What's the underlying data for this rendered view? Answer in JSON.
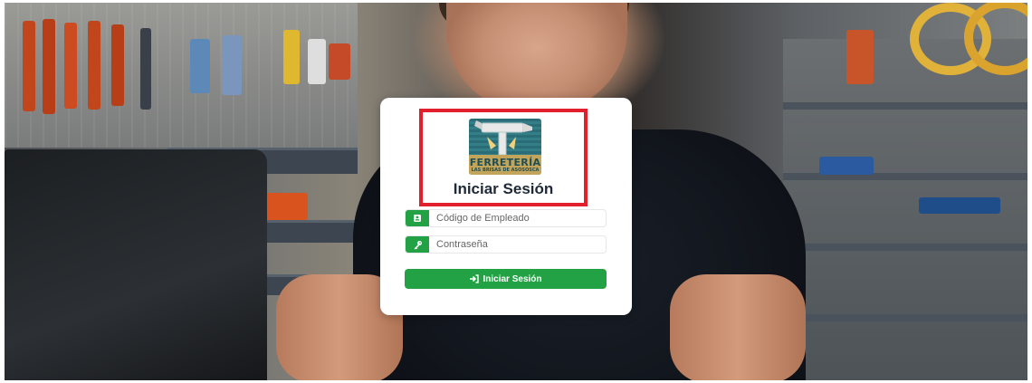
{
  "brand": {
    "logo_title": "FERRETERÍA",
    "logo_subtitle": "LAS BRISAS DE ASOSOSCA",
    "colors": {
      "accent": "#22a245",
      "highlight": "#e21f2c",
      "logo_teal": "#2b6d77",
      "logo_gold": "#c2a45b"
    }
  },
  "login": {
    "title": "Iniciar Sesión",
    "employee_code": {
      "placeholder": "Código de Empleado",
      "value": "",
      "icon": "id-card-icon"
    },
    "password": {
      "placeholder": "Contraseña",
      "value": "",
      "icon": "key-icon"
    },
    "submit": {
      "label": "Iniciar Sesión",
      "icon": "sign-in-icon"
    }
  },
  "background": {
    "description_icon": "hardware-store-photo"
  }
}
